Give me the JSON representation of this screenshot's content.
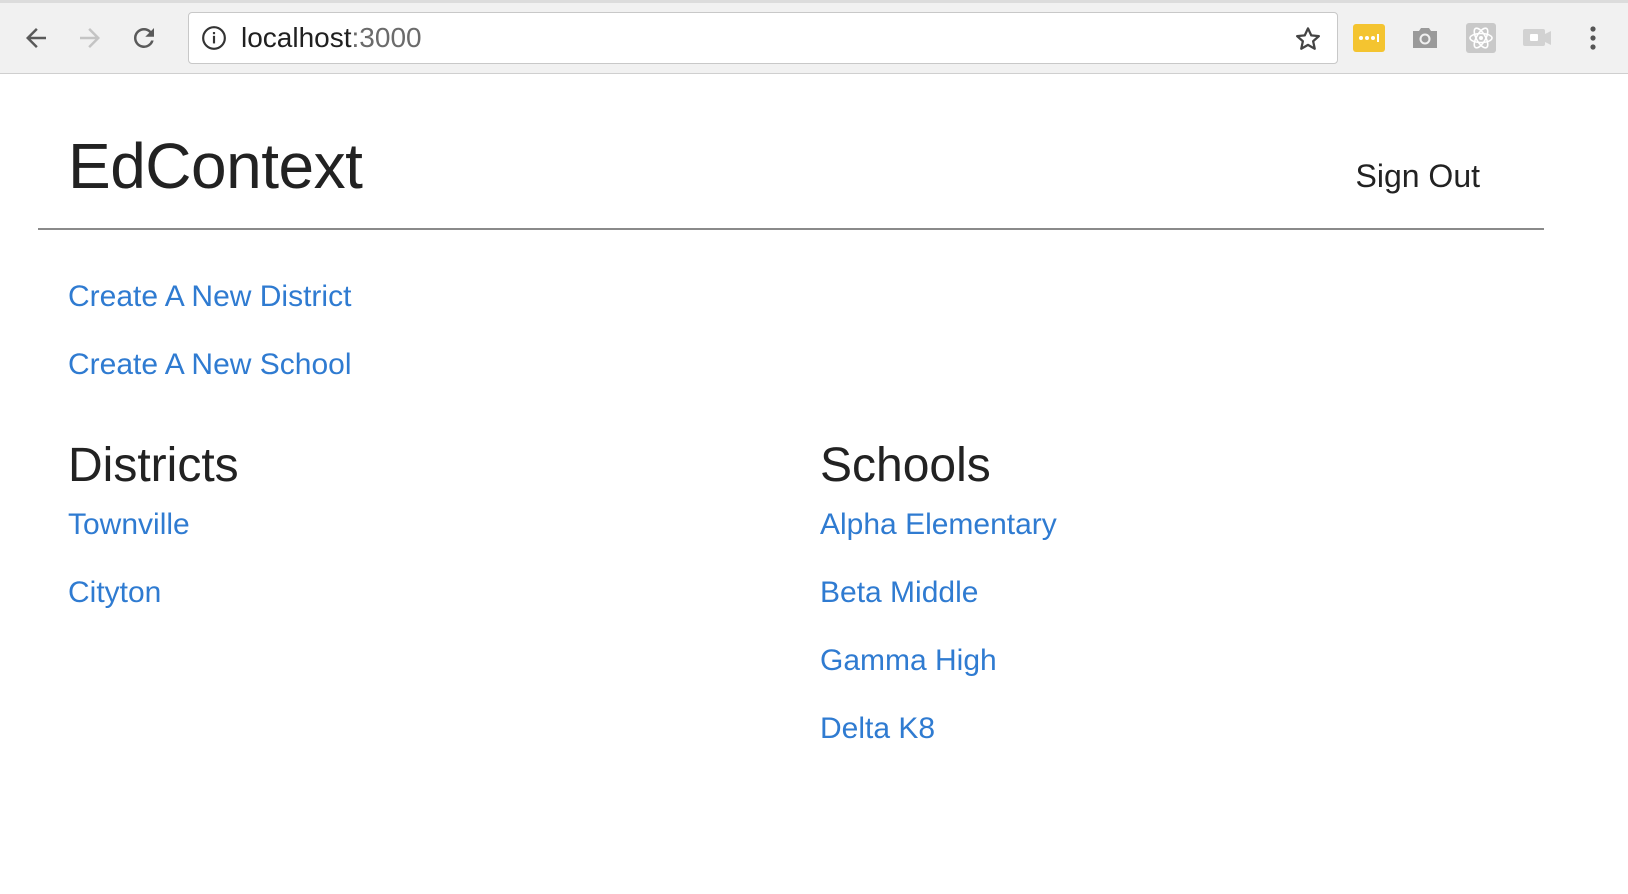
{
  "browser": {
    "url_host": "localhost",
    "url_port": ":3000",
    "toolbar_icons": [
      "back-icon",
      "forward-icon",
      "reload-icon",
      "info-icon",
      "star-icon",
      "menu-dots-icon"
    ],
    "extensions": [
      "password-manager-icon",
      "camera-icon",
      "react-devtools-icon",
      "cast-icon"
    ],
    "colors": {
      "extension_accent": "#f4c430",
      "toolbar_bg": "#f1f1f1"
    }
  },
  "header": {
    "brand": "EdContext",
    "sign_out": "Sign Out"
  },
  "actions": {
    "create_district": "Create A New District",
    "create_school": "Create A New School"
  },
  "districts": {
    "heading": "Districts",
    "items": [
      "Townville",
      "Cityton"
    ]
  },
  "schools": {
    "heading": "Schools",
    "items": [
      "Alpha Elementary",
      "Beta Middle",
      "Gamma High",
      "Delta K8"
    ]
  },
  "colors": {
    "link": "#2f7bd1",
    "text": "#222222",
    "divider": "#8a8a8a"
  }
}
